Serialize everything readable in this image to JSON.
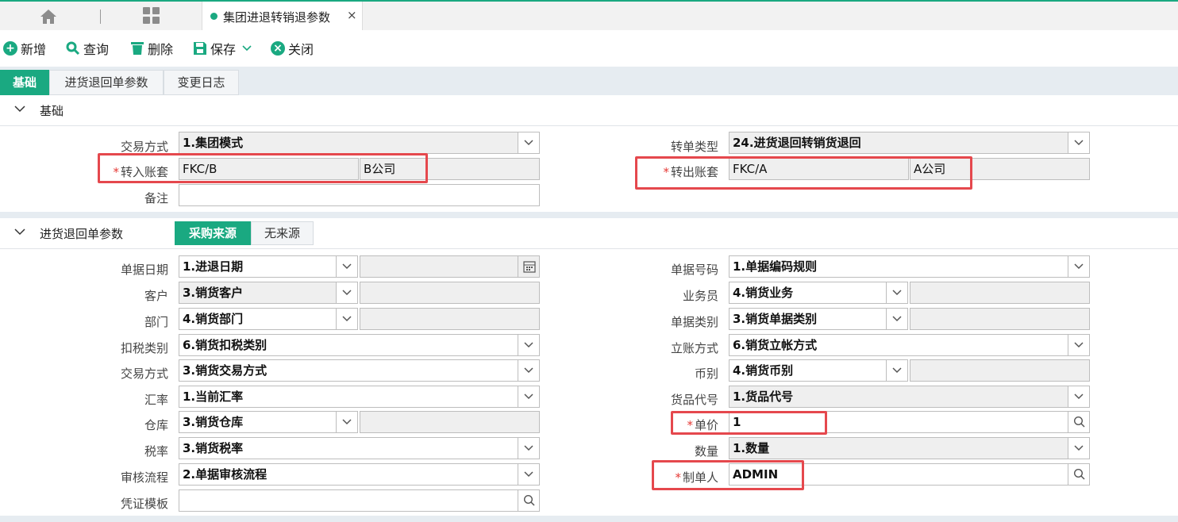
{
  "window": {
    "active_tab_title": "集团进退转销退参数",
    "tab_close": "×"
  },
  "toolbar": {
    "add": "新增",
    "query": "查询",
    "delete": "删除",
    "save": "保存",
    "close": "关闭"
  },
  "subtabs": [
    "基础",
    "进货退回单参数",
    "变更日志"
  ],
  "basic": {
    "section_title": "基础",
    "trade_mode_label": "交易方式",
    "trade_mode_value": "1.集团模式",
    "in_account_label": "转入账套",
    "in_account_code": "FKC/B",
    "in_account_name": "B公司",
    "remark_label": "备注",
    "remark_value": "",
    "doc_type_label": "转单类型",
    "doc_type_value": "24.进货退回转销货退回",
    "out_account_label": "转出账套",
    "out_account_code": "FKC/A",
    "out_account_name": "A公司",
    "required_mark": "*"
  },
  "return_params": {
    "section_title": "进货退回单参数",
    "source_tabs": [
      "采购来源",
      "无来源"
    ],
    "left": [
      {
        "label": "单据日期",
        "value": "1.进退日期"
      },
      {
        "label": "客户",
        "value": "3.销货客户"
      },
      {
        "label": "部门",
        "value": "4.销货部门"
      },
      {
        "label": "扣税类别",
        "value": "6.销货扣税类别"
      },
      {
        "label": "交易方式",
        "value": "3.销货交易方式"
      },
      {
        "label": "汇率",
        "value": "1.当前汇率"
      },
      {
        "label": "仓库",
        "value": "3.销货仓库"
      },
      {
        "label": "税率",
        "value": "3.销货税率"
      },
      {
        "label": "审核流程",
        "value": "2.单据审核流程"
      },
      {
        "label": "凭证模板",
        "value": ""
      }
    ],
    "right": [
      {
        "label": "单据号码",
        "value": "1.单据编码规则"
      },
      {
        "label": "业务员",
        "value": "4.销货业务"
      },
      {
        "label": "单据类别",
        "value": "3.销货单据类别"
      },
      {
        "label": "立账方式",
        "value": "6.销货立帐方式"
      },
      {
        "label": "币别",
        "value": "4.销货币别"
      },
      {
        "label": "货品代号",
        "value": "1.货品代号"
      },
      {
        "label": "单价",
        "value": "1"
      },
      {
        "label": "数量",
        "value": "1.数量"
      },
      {
        "label": "制单人",
        "value": "ADMIN"
      }
    ]
  },
  "icons": [
    "home-icon",
    "grid-icon",
    "plus-circle-icon",
    "search-icon",
    "trash-icon",
    "floppy-icon",
    "chevron-down-icon",
    "close-circle-icon",
    "calendar-icon"
  ],
  "colors": {
    "accent": "#1aa981",
    "highlight": "#e5484d"
  }
}
